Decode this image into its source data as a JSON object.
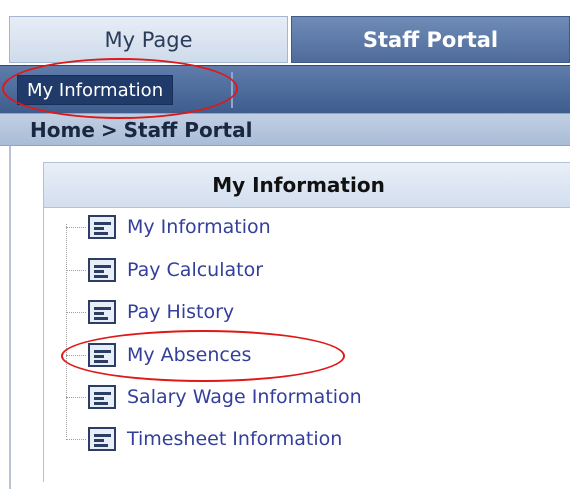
{
  "tabs": [
    {
      "label": "My Page",
      "active": false
    },
    {
      "label": "Staff Portal",
      "active": true
    }
  ],
  "subnav": {
    "active_item": "My Information"
  },
  "breadcrumb": {
    "home": "Home",
    "separator": ">",
    "current": "Staff Portal"
  },
  "panel": {
    "title": "My Information",
    "items": [
      {
        "label": "My Information",
        "icon": "document-list-icon"
      },
      {
        "label": "Pay Calculator",
        "icon": "document-list-icon"
      },
      {
        "label": "Pay History",
        "icon": "document-list-icon"
      },
      {
        "label": "My Absences",
        "icon": "document-list-icon"
      },
      {
        "label": "Salary Wage Information",
        "icon": "document-list-icon"
      },
      {
        "label": "Timesheet Information",
        "icon": "document-list-icon"
      }
    ]
  },
  "annotations": {
    "color": "#e01818",
    "highlighted": [
      "My Information",
      "My Absences"
    ]
  },
  "colors": {
    "nav_dark": "#203b6a",
    "link": "#333f9a",
    "tab_active": "#5a77a6"
  }
}
